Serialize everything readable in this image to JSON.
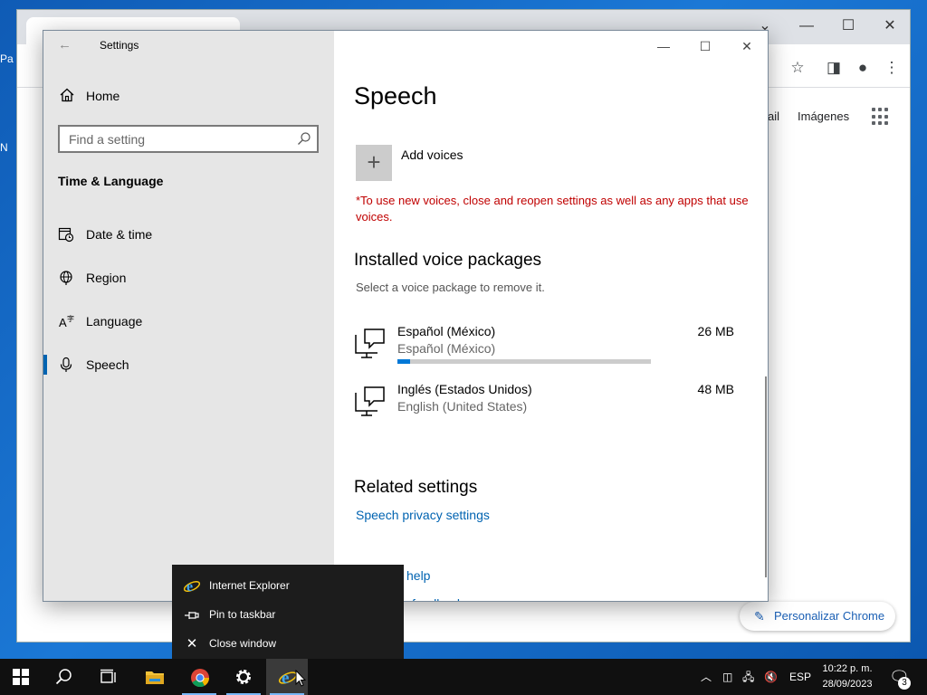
{
  "chrome": {
    "links": {
      "gmail": "ail",
      "images": "Imágenes"
    },
    "customize_label": "Personalizar Chrome",
    "icons": [
      "minimize-icon",
      "maximize-icon",
      "close-icon",
      "star-icon",
      "sidebar-icon",
      "profile-icon",
      "menu-icon",
      "apps-icon",
      "pencil-icon"
    ]
  },
  "desktop": {
    "fragments": [
      "Pa",
      "N"
    ]
  },
  "settings": {
    "window_title": "Settings",
    "home_label": "Home",
    "search_placeholder": "Find a setting",
    "section_title": "Time & Language",
    "nav": [
      {
        "label": "Date & time",
        "icon": "calendar-clock-icon"
      },
      {
        "label": "Region",
        "icon": "globe-icon"
      },
      {
        "label": "Language",
        "icon": "language-icon"
      },
      {
        "label": "Speech",
        "icon": "microphone-icon",
        "active": true
      }
    ],
    "page_title": "Speech",
    "add_voices_label": "Add voices",
    "warning": "*To use new voices, close and reopen settings as well as any apps that use voices.",
    "installed_title": "Installed voice packages",
    "installed_subtitle": "Select a voice package to remove it.",
    "voices": [
      {
        "name": "Español (México)",
        "sub": "Español (México)",
        "size": "26 MB",
        "progress": 0.05
      },
      {
        "name": "Inglés (Estados Unidos)",
        "sub": "English (United States)",
        "size": "48 MB"
      }
    ],
    "related_title": "Related settings",
    "privacy_link": "Speech privacy settings",
    "help_fragment": "help",
    "feedback_fragment": "feedback",
    "accent_color": "#0063b1",
    "warning_color": "#c00000"
  },
  "context_menu": {
    "items": [
      {
        "label": "Internet Explorer",
        "icon": "internet-explorer-icon"
      },
      {
        "label": "Pin to taskbar",
        "icon": "pin-icon"
      },
      {
        "label": "Close window",
        "icon": "close-icon"
      }
    ]
  },
  "taskbar": {
    "apps": [
      "start-icon",
      "search-icon",
      "task-view-icon",
      "file-explorer-icon",
      "chrome-icon",
      "settings-gear-icon",
      "internet-explorer-icon"
    ],
    "language": "ESP",
    "time": "10:22 p. m.",
    "date": "28/09/2023",
    "notification_count": "3"
  }
}
